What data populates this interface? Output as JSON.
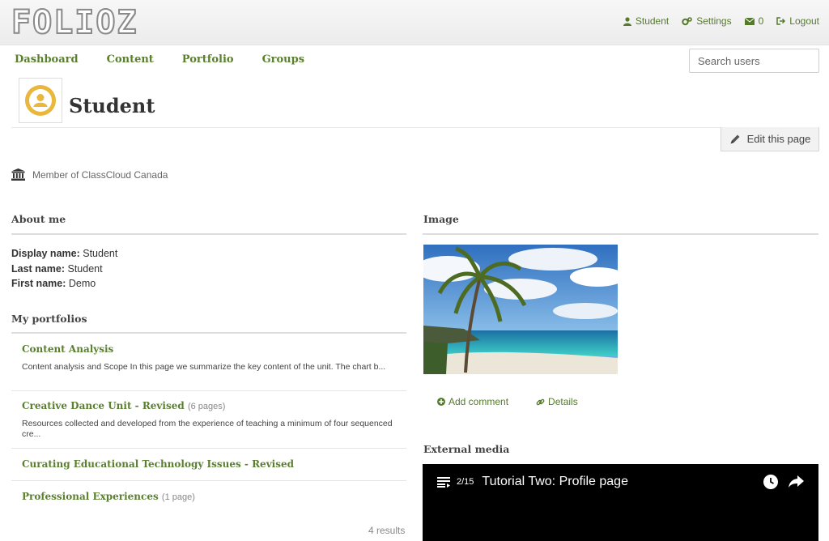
{
  "header": {
    "logo_text": "FOLIOZ",
    "menu": [
      {
        "label": "Student",
        "icon": "user-icon"
      },
      {
        "label": "Settings",
        "icon": "gears-icon"
      },
      {
        "label": "0",
        "icon": "envelope-icon"
      },
      {
        "label": "Logout",
        "icon": "logout-icon"
      }
    ]
  },
  "nav": {
    "items": [
      "Dashboard",
      "Content",
      "Portfolio",
      "Groups"
    ],
    "search_placeholder": "Search users"
  },
  "profile": {
    "name": "Student",
    "edit_label": "Edit this page",
    "member_text": "Member of ClassCloud Canada"
  },
  "about": {
    "title": "About me",
    "rows": [
      {
        "label": "Display name:",
        "value": "Student"
      },
      {
        "label": "Last name:",
        "value": "Student"
      },
      {
        "label": "First name:",
        "value": "Demo"
      }
    ]
  },
  "portfolios": {
    "title": "My portfolios",
    "items": [
      {
        "title": "Content Analysis",
        "count": "",
        "desc": "Content analysis and Scope In this page we summarize the key content of the unit.  The chart b..."
      },
      {
        "title": "Creative Dance Unit - Revised",
        "count": "(6 pages)",
        "desc": "Resources collected and developed from the experience of teaching a minimum of four sequenced cre..."
      },
      {
        "title": "Curating Educational Technology Issues - Revised",
        "count": "",
        "desc": ""
      },
      {
        "title": "Professional Experiences",
        "count": "(1 page)",
        "desc": ""
      }
    ],
    "results": "4 results"
  },
  "image_block": {
    "title": "Image",
    "add_comment": "Add comment",
    "details": "Details"
  },
  "media": {
    "title": "External media",
    "counter": "2/15",
    "video_title": "Tutorial Two: Profile page"
  },
  "colors": {
    "accent": "#5a7f2f",
    "avatar": "#e8b73c"
  }
}
